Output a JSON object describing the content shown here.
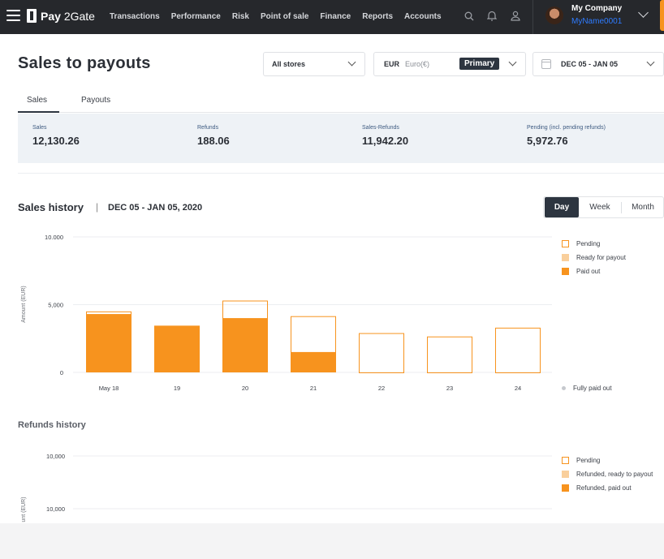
{
  "nav": {
    "logo_bold": "Pay",
    "logo_thin": "2Gate",
    "items": [
      "Transactions",
      "Performance",
      "Risk",
      "Point of sale",
      "Finance",
      "Reports",
      "Accounts"
    ],
    "company": "My Company",
    "username": "MyName0001"
  },
  "page": {
    "title": "Sales to payouts",
    "store_select": "All stores",
    "currency_code": "EUR",
    "currency_name": "Euro(€)",
    "currency_badge": "Primary",
    "date_range": "DEC 05 - JAN 05",
    "tabs": [
      "Sales",
      "Payouts"
    ]
  },
  "summary": [
    {
      "label": "Sales",
      "value": "12,130.26"
    },
    {
      "label": "Refunds",
      "value": "188.06"
    },
    {
      "label": "Sales-Refunds",
      "value": "11,942.20"
    },
    {
      "label": "Pending (incl. pending refunds)",
      "value": "5,972.76"
    }
  ],
  "sales_history": {
    "title": "Sales history",
    "range": "DEC 05 - JAN 05, 2020",
    "toggle": [
      "Day",
      "Week",
      "Month"
    ],
    "fully_paid_label": "Fully paid out"
  },
  "refunds_history": {
    "title": "Refunds history"
  },
  "colors": {
    "accent": "#f7931e",
    "ready": "#f9cf9c",
    "nav_bg": "#26282c",
    "badge_bg": "#2d3540"
  },
  "chart_data": [
    {
      "type": "bar",
      "stacked": true,
      "ylabel": "Amount (EUR)",
      "ylim": [
        0,
        10000
      ],
      "yticks": [
        "0",
        "5,000",
        "10.000"
      ],
      "ytick_values": [
        0,
        5000,
        10000
      ],
      "categories": [
        "May  18",
        "19",
        "20",
        "21",
        "22",
        "23",
        "24"
      ],
      "series": [
        {
          "name": "Paid out",
          "style": "filled",
          "values": [
            4300,
            3450,
            4000,
            1500,
            0,
            0,
            0
          ]
        },
        {
          "name": "Ready for payout",
          "style": "light",
          "values": [
            0,
            0,
            0,
            0,
            0,
            0,
            0
          ]
        },
        {
          "name": "Pending",
          "style": "outline",
          "values": [
            200,
            0,
            1300,
            2650,
            2900,
            2650,
            3300
          ]
        }
      ],
      "legend": [
        "Pending",
        "Ready for payout",
        "Paid out"
      ],
      "legend_position": "right"
    },
    {
      "type": "bar",
      "ylabel": "unt (EUR)",
      "yticks": [
        "10,000",
        "10,000"
      ],
      "categories": [],
      "series": [],
      "legend": [
        "Pending",
        "Refunded, ready to payout",
        "Refunded, paid out"
      ],
      "legend_position": "right"
    }
  ]
}
